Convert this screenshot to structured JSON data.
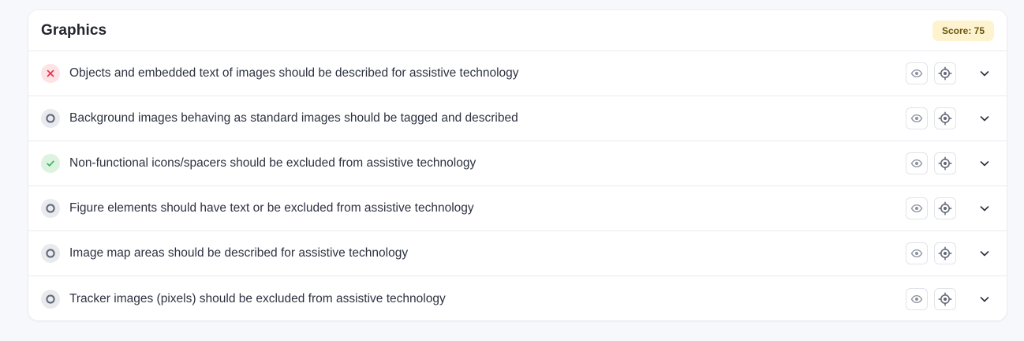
{
  "card": {
    "title": "Graphics",
    "score_label": "Score: 75"
  },
  "colors": {
    "fail": "#e0344a",
    "pass": "#3aaa55",
    "na": "#5f6675",
    "score_bg": "#fdf3cf"
  },
  "rules": [
    {
      "status": "fail",
      "text": "Objects and embedded text of images should be described for assistive technology"
    },
    {
      "status": "not-applicable",
      "text": "Background images behaving as standard images should be tagged and described"
    },
    {
      "status": "pass",
      "text": "Non-functional icons/spacers should be excluded from assistive technology"
    },
    {
      "status": "not-applicable",
      "text": "Figure elements should have text or be excluded from assistive technology"
    },
    {
      "status": "not-applicable",
      "text": "Image map areas should be described for assistive technology"
    },
    {
      "status": "not-applicable",
      "text": "Tracker images (pixels) should be excluded from assistive technology"
    }
  ],
  "row_actions": {
    "view_icon": "eye-icon",
    "locate_icon": "crosshair-icon",
    "expand_icon": "chevron-down-icon"
  }
}
